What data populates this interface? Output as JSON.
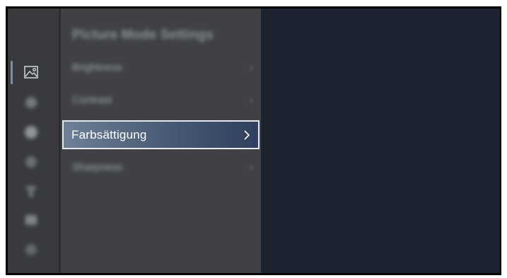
{
  "menu": {
    "title": "Picture Mode Settings",
    "items": [
      {
        "label": "Brightness"
      },
      {
        "label": "Contrast"
      },
      {
        "label": "Farbsättigung"
      },
      {
        "label": "Sharpness"
      }
    ],
    "focused_index": 2
  },
  "icons": {
    "picture": "picture-icon",
    "sound": "sound-icon",
    "channel": "channel-icon",
    "network": "network-icon",
    "system": "system-icon",
    "accessibility": "accessibility-icon",
    "support": "support-icon",
    "chevron": "chevron-right-icon"
  },
  "colors": {
    "screen_bg": "#000000",
    "rail_bg": "#383a3e",
    "panel_bg": "#3f4145",
    "preview_bg": "#1c2432",
    "focus_border": "#e6e9f0",
    "focus_fill_start": "#6f8097",
    "focus_fill_end": "#2f3f5d",
    "active_indicator": "#7d8ea6"
  }
}
